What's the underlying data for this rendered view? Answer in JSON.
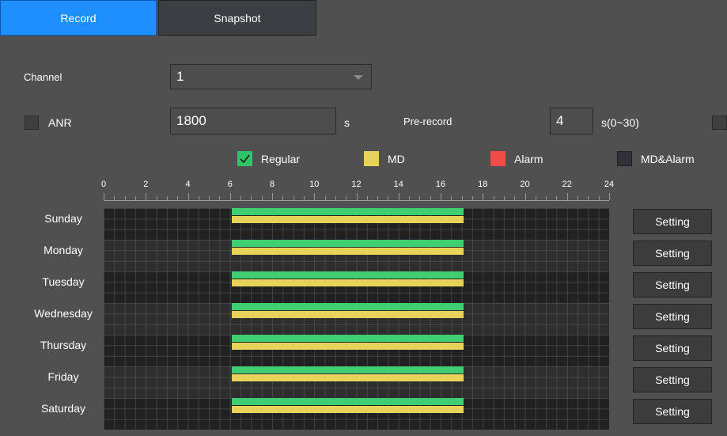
{
  "tabs": [
    {
      "label": "Record",
      "active": true
    },
    {
      "label": "Snapshot",
      "active": false
    }
  ],
  "channel": {
    "label": "Channel",
    "value": "1"
  },
  "anr": {
    "label": "ANR",
    "checked": false,
    "value": "1800",
    "unit": "s"
  },
  "prerecord": {
    "label": "Pre-record",
    "value": "4",
    "unit": "s(0~30)"
  },
  "legend": [
    {
      "label": "Regular",
      "color": "#2ec46a",
      "checked": true
    },
    {
      "label": "MD",
      "color": "#e8d35a"
    },
    {
      "label": "Alarm",
      "color": "#f34a4a"
    },
    {
      "label": "MD&Alarm",
      "color": "#2f3338"
    }
  ],
  "hours": [
    "0",
    "2",
    "4",
    "6",
    "8",
    "10",
    "12",
    "14",
    "16",
    "18",
    "20",
    "22",
    "24"
  ],
  "colors": {
    "regular": "#3fcf72",
    "md": "#e8d35a",
    "accent": "#1f8fff"
  },
  "schedule": [
    {
      "day": "Sunday",
      "start": 6.1,
      "end": 17.1,
      "setting": "Setting"
    },
    {
      "day": "Monday",
      "start": 6.1,
      "end": 17.1,
      "setting": "Setting"
    },
    {
      "day": "Tuesday",
      "start": 6.1,
      "end": 17.1,
      "setting": "Setting"
    },
    {
      "day": "Wednesday",
      "start": 6.1,
      "end": 17.1,
      "setting": "Setting"
    },
    {
      "day": "Thursday",
      "start": 6.1,
      "end": 17.1,
      "setting": "Setting"
    },
    {
      "day": "Friday",
      "start": 6.1,
      "end": 17.1,
      "setting": "Setting"
    },
    {
      "day": "Saturday",
      "start": 6.1,
      "end": 17.1,
      "setting": "Setting"
    }
  ]
}
